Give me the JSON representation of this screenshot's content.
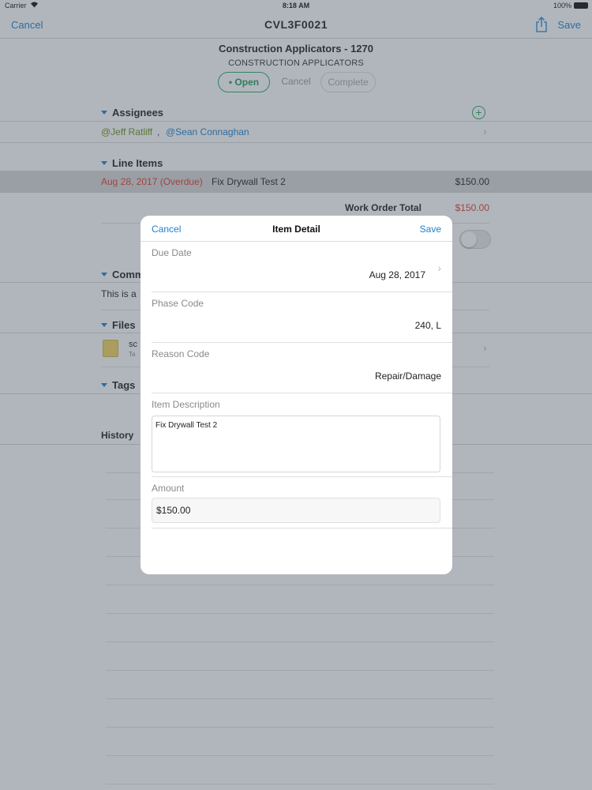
{
  "status_bar": {
    "carrier": "Carrier",
    "time": "8:18 AM",
    "battery": "100%"
  },
  "nav": {
    "cancel": "Cancel",
    "title": "CVL3F0021",
    "save": "Save",
    "share_icon": "share-icon"
  },
  "work_order": {
    "title": "Construction Applicators - 1270",
    "subtitle": "CONSTRUCTION APPLICATORS"
  },
  "status_segments": {
    "open": "• Open",
    "cancel": "Cancel",
    "complete": "Complete"
  },
  "assignees": {
    "header": "Assignees",
    "items": [
      "@Jeff Ratliff",
      "@Sean Connaghan"
    ],
    "separator": ","
  },
  "line_items": {
    "header": "Line Items",
    "rows": [
      {
        "date": "Aug 28, 2017 (Overdue)",
        "description": "Fix Drywall Test 2",
        "amount": "$150.00"
      }
    ],
    "total_label": "Work Order Total",
    "total_value": "$150.00"
  },
  "comments": {
    "header": "Comm",
    "text": "This is a"
  },
  "files": {
    "header": "Files",
    "file_name": "sc",
    "file_sub": "Ta"
  },
  "tags": {
    "header": "Tags"
  },
  "history": {
    "header": "History"
  },
  "colors": {
    "accent": "#1a82d2",
    "overdue": "#e23a2a",
    "open_green": "#239b56"
  },
  "modal": {
    "cancel": "Cancel",
    "title": "Item Detail",
    "save": "Save",
    "due_date": {
      "label": "Due Date",
      "value": "Aug 28, 2017"
    },
    "phase_code": {
      "label": "Phase Code",
      "value": "240, L"
    },
    "reason_code": {
      "label": "Reason Code",
      "value": "Repair/Damage"
    },
    "item_description": {
      "label": "Item Description",
      "value": "Fix Drywall Test 2"
    },
    "amount": {
      "label": "Amount",
      "value": "$150.00"
    }
  }
}
